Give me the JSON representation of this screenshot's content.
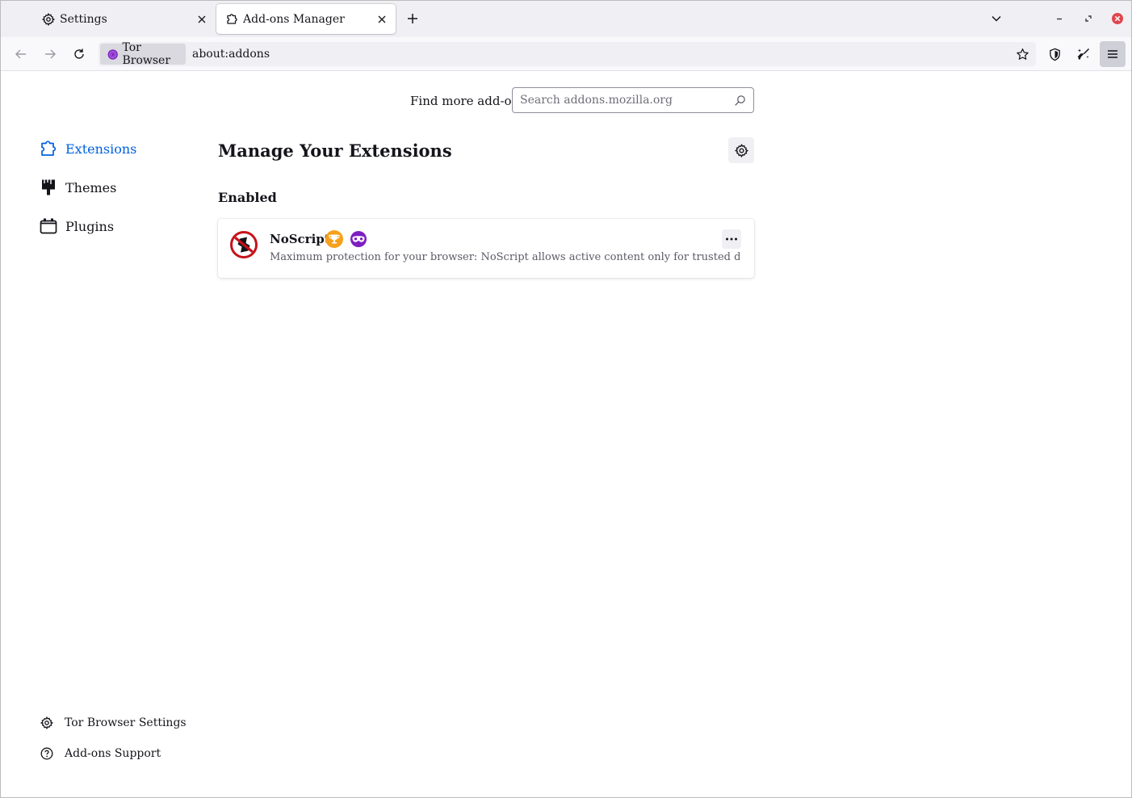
{
  "tabs": [
    {
      "label": "Settings",
      "icon": "gear-icon",
      "active": false
    },
    {
      "label": "Add-ons Manager",
      "icon": "puzzle-icon",
      "active": true
    }
  ],
  "navbar": {
    "identity_label": "Tor Browser",
    "url": "about:addons"
  },
  "search": {
    "label": "Find more add-ons",
    "placeholder": "Search addons.mozilla.org"
  },
  "sidebar": {
    "categories": [
      {
        "label": "Extensions",
        "icon": "puzzle-icon",
        "selected": true
      },
      {
        "label": "Themes",
        "icon": "brush-icon",
        "selected": false
      },
      {
        "label": "Plugins",
        "icon": "plugin-icon",
        "selected": false
      }
    ],
    "footer": [
      {
        "label": "Tor Browser Settings",
        "icon": "gear-icon"
      },
      {
        "label": "Add-ons Support",
        "icon": "help-icon"
      }
    ]
  },
  "main": {
    "title": "Manage Your Extensions",
    "section": "Enabled",
    "extensions": [
      {
        "name": "NoScript",
        "description": "Maximum protection for your browser: NoScript allows active content only for trusted domains of y...",
        "badges": [
          "recommended-badge-icon",
          "private-browsing-badge-icon"
        ]
      }
    ]
  },
  "colors": {
    "accent": "#0061e0",
    "tor_purple": "#7e1fc1",
    "recommended_orange": "#f7a01a",
    "close_red": "#e0464f"
  }
}
